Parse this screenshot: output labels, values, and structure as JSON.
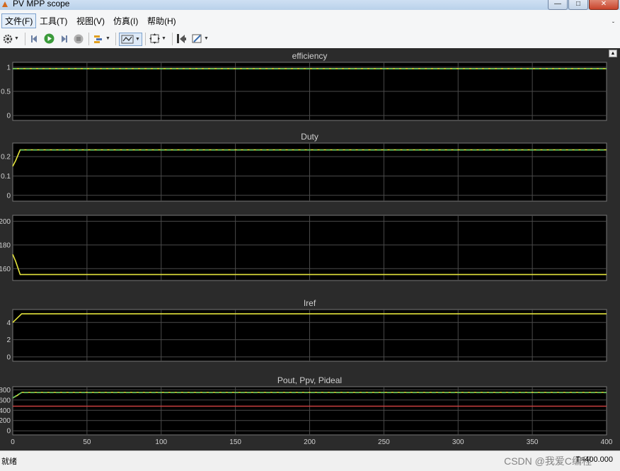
{
  "window": {
    "title": "PV MPP scope",
    "minimize": "—",
    "maximize": "□",
    "close": "✕"
  },
  "menu": {
    "items": [
      "文件(F)",
      "工具(T)",
      "视图(V)",
      "仿真(I)",
      "帮助(H)"
    ],
    "expand": "ˬ"
  },
  "toolbar": {
    "icons": [
      "gear-icon",
      "step-back-icon",
      "run-icon",
      "step-forward-icon",
      "stop-icon",
      "highlight-icon",
      "zoom-icon",
      "autoscale-icon",
      "restore-icon",
      "cursor-icon"
    ]
  },
  "status": {
    "left": "就绪",
    "right": "T=400.000",
    "watermark": "CSDN @我爱C编程"
  },
  "colors": {
    "background": "#2b2b2b",
    "axes": "#000000",
    "grid": "#4a4a4a",
    "text": "#d0d0d0",
    "yellow": "#e3e33c",
    "green": "#5fbf5f",
    "red": "#c84040"
  },
  "chart_data": [
    {
      "type": "line",
      "title": "efficiency",
      "xlim": [
        0,
        400
      ],
      "yticks": [
        "0",
        "0.5",
        "1"
      ],
      "ylim": [
        -0.1,
        1.1
      ],
      "series": [
        {
          "color": "yellow",
          "x": [
            0,
            400
          ],
          "y": [
            0.97,
            0.97
          ]
        },
        {
          "color": "green",
          "x": [
            0,
            400
          ],
          "y": [
            0.965,
            0.965
          ]
        }
      ]
    },
    {
      "type": "line",
      "title": "Duty",
      "xlim": [
        0,
        400
      ],
      "yticks": [
        "0",
        "0.1",
        "0.2"
      ],
      "ylim": [
        -0.03,
        0.27
      ],
      "series": [
        {
          "color": "yellow",
          "x": [
            0,
            2,
            5,
            400
          ],
          "y": [
            0.15,
            0.18,
            0.235,
            0.235
          ]
        },
        {
          "color": "green",
          "x": [
            5,
            400
          ],
          "y": [
            0.234,
            0.234
          ]
        }
      ]
    },
    {
      "type": "line",
      "title": "",
      "xlim": [
        0,
        400
      ],
      "yticks": [
        "160",
        "180",
        "200"
      ],
      "ylim": [
        150,
        205
      ],
      "series": [
        {
          "color": "yellow",
          "x": [
            0,
            2,
            5,
            400
          ],
          "y": [
            172,
            166,
            155,
            155
          ]
        }
      ]
    },
    {
      "type": "line",
      "title": "Iref",
      "xlim": [
        0,
        400
      ],
      "yticks": [
        "0",
        "2",
        "4"
      ],
      "ylim": [
        -0.5,
        5.5
      ],
      "series": [
        {
          "color": "yellow",
          "x": [
            0,
            3,
            6,
            400
          ],
          "y": [
            4.0,
            4.5,
            5.0,
            5.0
          ]
        }
      ]
    },
    {
      "type": "line",
      "title": "Pout, Ppv, Pideal",
      "xlim": [
        0,
        400
      ],
      "yticks": [
        "0",
        "200",
        "400",
        "600",
        "800"
      ],
      "ylim": [
        -80,
        860
      ],
      "xticks": [
        "0",
        "50",
        "100",
        "150",
        "200",
        "250",
        "300",
        "350",
        "400"
      ],
      "series": [
        {
          "color": "yellow",
          "x": [
            0,
            3,
            6,
            400
          ],
          "y": [
            640,
            690,
            750,
            750
          ]
        },
        {
          "color": "green",
          "x": [
            0,
            3,
            6,
            400
          ],
          "y": [
            640,
            700,
            745,
            745
          ]
        },
        {
          "color": "red",
          "x": [
            0,
            400
          ],
          "y": [
            480,
            480
          ]
        }
      ]
    }
  ]
}
